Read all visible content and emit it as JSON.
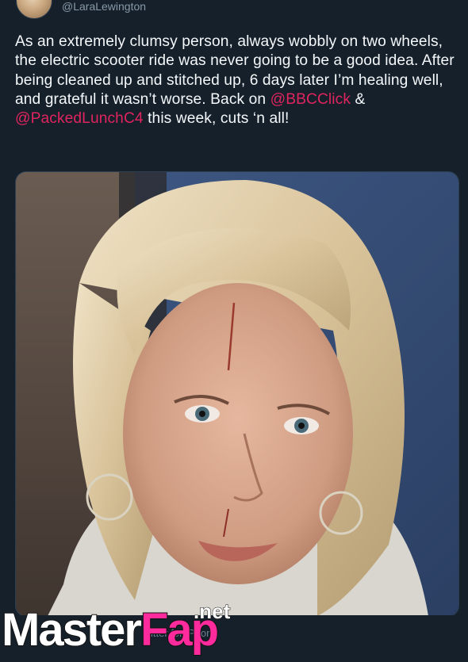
{
  "author": {
    "handle": "@LaraLewington"
  },
  "tweet": {
    "text_part1": "As an extremely clumsy person, always wobbly on two wheels, the electric scooter ride was never going to be a good idea. After being cleaned up and stitched up, 6 days later I’m healing well, and grateful it wasn’t worse. Back on ",
    "mention1": "@BBCClick",
    "text_part2": " & ",
    "mention2": "@PackedLunchC4",
    "text_part3": " this week, cuts ‘n all!"
  },
  "photo": {
    "subject": "selfie-with-facial-injuries"
  },
  "caption_ghost": "itter for iPhone",
  "watermark": {
    "part1": "Master",
    "part2": "Fap",
    "suffix": ".net"
  },
  "colors": {
    "background": "#15202b",
    "text": "#f5f8fa",
    "muted": "#8899a6",
    "mention": "#e0245e",
    "watermark_accent": "#ff2b9c"
  }
}
